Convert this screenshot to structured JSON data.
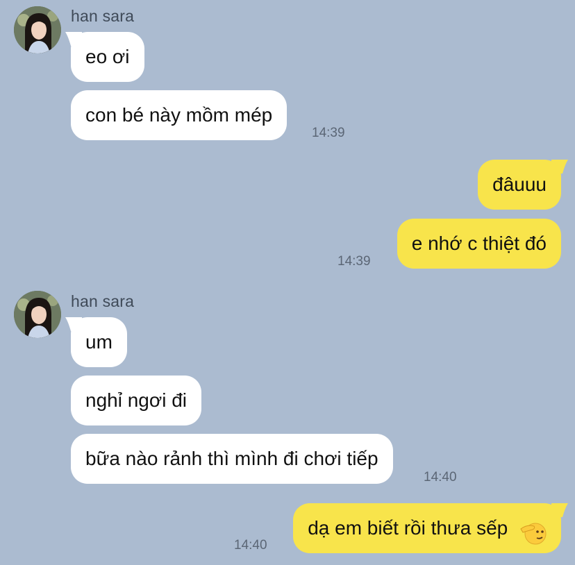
{
  "colors": {
    "background": "#abbbd0",
    "incoming_bubble": "#ffffff",
    "outgoing_bubble": "#f8e44b",
    "timestamp": "#5b6675"
  },
  "groups": [
    {
      "sender": "han sara",
      "messages": [
        {
          "text": "eo ơi"
        },
        {
          "text": "con bé này mồm mép",
          "time": "14:39"
        }
      ]
    },
    {
      "sender": "me",
      "messages": [
        {
          "text": "đâuuu"
        },
        {
          "text": "e nhớ c thiệt đó",
          "time": "14:39"
        }
      ]
    },
    {
      "sender": "han sara",
      "messages": [
        {
          "text": "um"
        },
        {
          "text": "nghỉ ngơi đi"
        },
        {
          "text": "bữa nào rảnh thì mình đi chơi tiếp",
          "time": "14:40"
        }
      ]
    },
    {
      "sender": "me",
      "messages": [
        {
          "text": "dạ em biết rồi thưa sếp",
          "emoji": "saluting-face-icon",
          "time": "14:40"
        }
      ]
    }
  ]
}
